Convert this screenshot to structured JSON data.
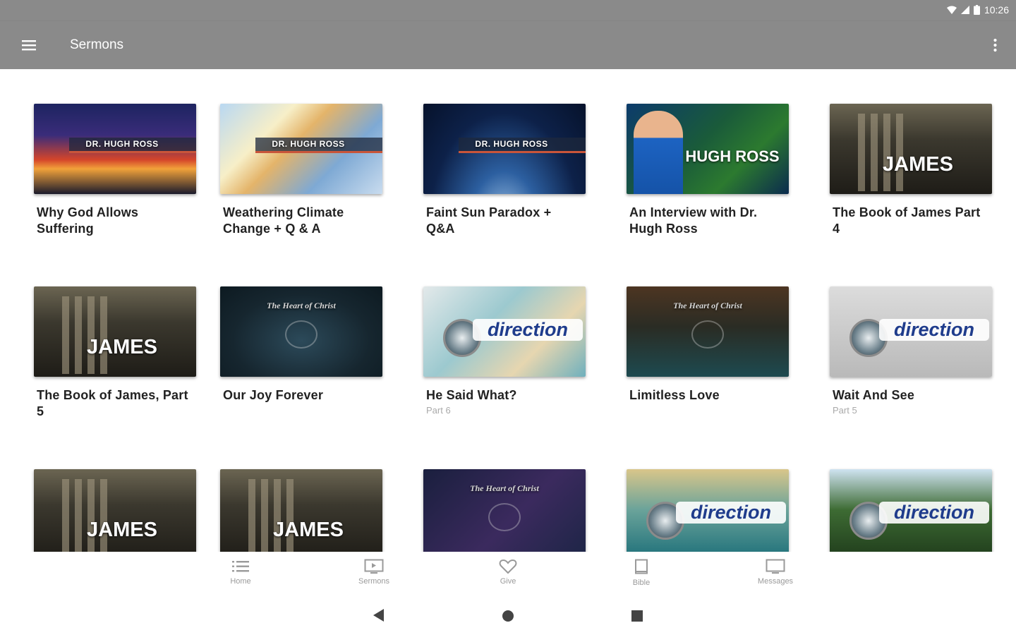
{
  "status": {
    "time": "10:26"
  },
  "app_bar": {
    "title": "Sermons"
  },
  "cards": [
    {
      "title": "Why God Allows Suffering",
      "subtitle": "",
      "thumb_text": "DR. HUGH ROSS",
      "thumb_style": "space-orange"
    },
    {
      "title": "Weathering Climate Change + Q & A",
      "subtitle": "",
      "thumb_text": "DR. HUGH ROSS",
      "thumb_style": "earth"
    },
    {
      "title": "Faint Sun Paradox + Q&A",
      "subtitle": "",
      "thumb_text": "DR. HUGH ROSS",
      "thumb_style": "space-blue"
    },
    {
      "title": "An Interview with Dr. Hugh Ross",
      "subtitle": "",
      "thumb_text": "HUGH ROSS",
      "thumb_style": "interview"
    },
    {
      "title": "The Book of James Part 4",
      "subtitle": "",
      "thumb_text": "JAMES",
      "thumb_style": "james"
    },
    {
      "title": "The Book of James, Part 5",
      "subtitle": "",
      "thumb_text": "JAMES",
      "thumb_style": "james"
    },
    {
      "title": "Our Joy Forever",
      "subtitle": "",
      "thumb_text": "The Heart of Christ",
      "thumb_style": "heart-teal"
    },
    {
      "title": "He Said What?",
      "subtitle": "Part 6",
      "thumb_text": "direction",
      "thumb_style": "direction-map"
    },
    {
      "title": "Limitless Love",
      "subtitle": "",
      "thumb_text": "The Heart of Christ",
      "thumb_style": "heart-brown"
    },
    {
      "title": "Wait And See",
      "subtitle": "Part 5",
      "thumb_text": "direction",
      "thumb_style": "direction-grey"
    },
    {
      "title": "",
      "subtitle": "",
      "thumb_text": "JAMES",
      "thumb_style": "james"
    },
    {
      "title": "",
      "subtitle": "",
      "thumb_text": "JAMES",
      "thumb_style": "james"
    },
    {
      "title": "",
      "subtitle": "",
      "thumb_text": "The Heart of Christ",
      "thumb_style": "heart-purple"
    },
    {
      "title": "",
      "subtitle": "",
      "thumb_text": "direction",
      "thumb_style": "direction-sea"
    },
    {
      "title": "",
      "subtitle": "",
      "thumb_text": "direction",
      "thumb_style": "direction-forest"
    }
  ],
  "bottom_nav": [
    {
      "label": "Home",
      "icon": "list-icon"
    },
    {
      "label": "Sermons",
      "icon": "play-screen-icon"
    },
    {
      "label": "Give",
      "icon": "heart-icon"
    },
    {
      "label": "Bible",
      "icon": "book-icon"
    },
    {
      "label": "Messages",
      "icon": "monitor-icon"
    }
  ]
}
